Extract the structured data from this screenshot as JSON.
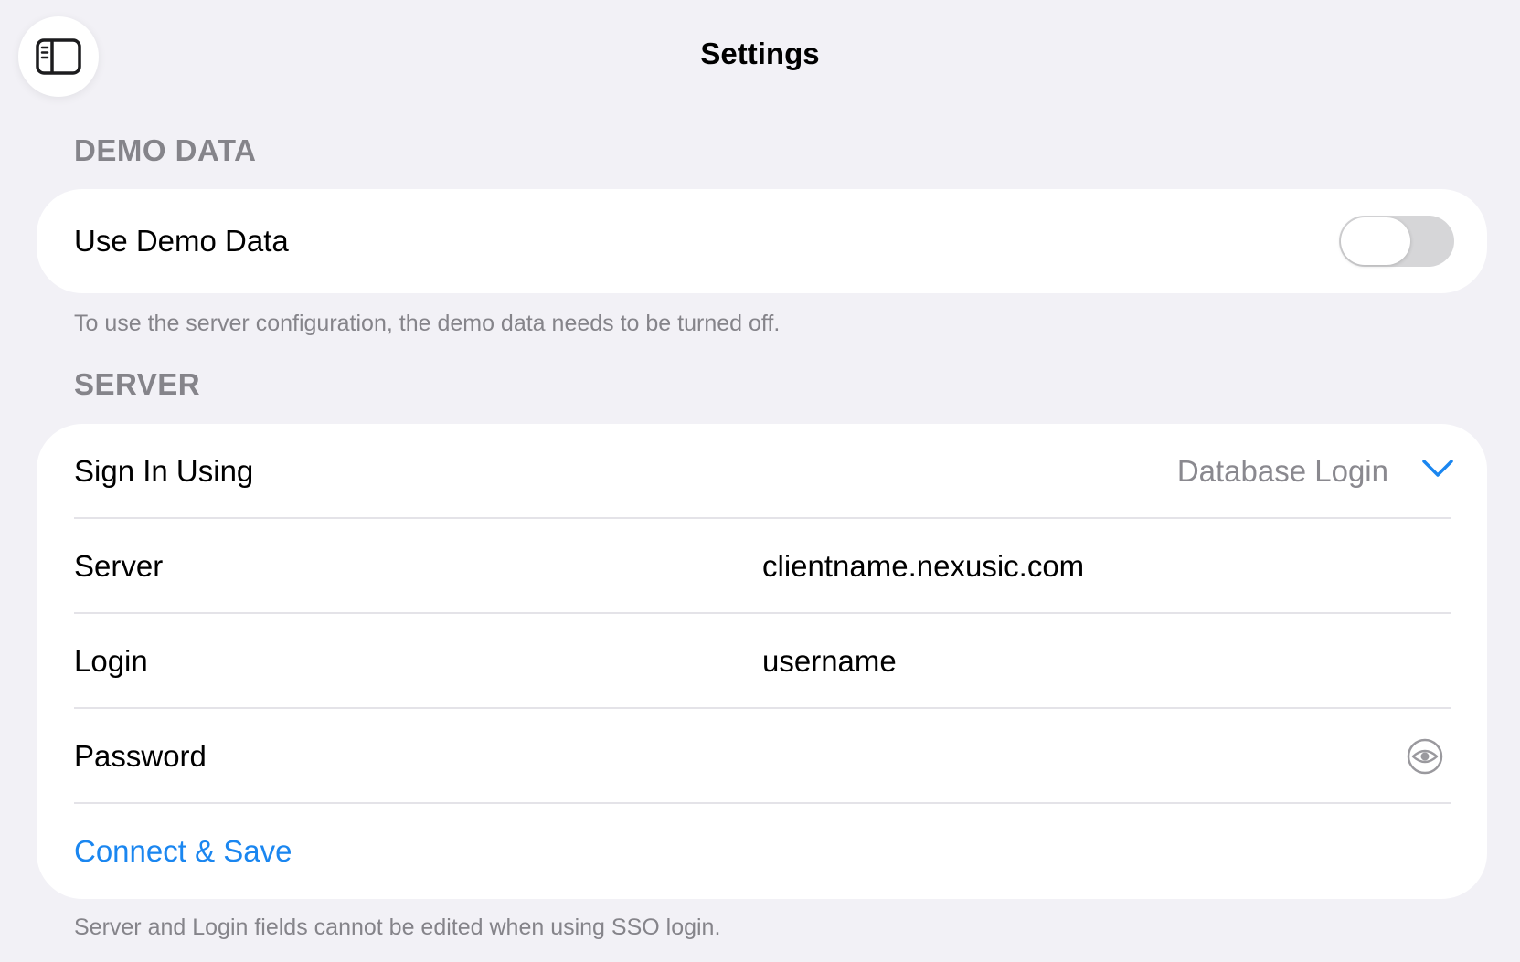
{
  "header": {
    "title": "Settings",
    "sidebar_toggle_icon": "sidebar-toggle-icon"
  },
  "demo_section": {
    "header": "DEMO DATA",
    "use_demo_label": "Use Demo Data",
    "use_demo_enabled": false,
    "footer": "To use the server configuration, the demo data needs to be turned off."
  },
  "server_section": {
    "header": "SERVER",
    "sign_in_label": "Sign In Using",
    "sign_in_value": "Database Login",
    "server_label": "Server",
    "server_value": "clientname.nexusic.com",
    "login_label": "Login",
    "login_value": "username",
    "password_label": "Password",
    "password_value": "",
    "connect_label": "Connect & Save",
    "footer": "Server and Login fields cannot be edited when using SSO login."
  },
  "colors": {
    "background": "#f2f1f6",
    "card": "#ffffff",
    "accent": "#1a86f0",
    "secondary_text": "#85848a",
    "toggle_off": "#d6d6d8"
  }
}
